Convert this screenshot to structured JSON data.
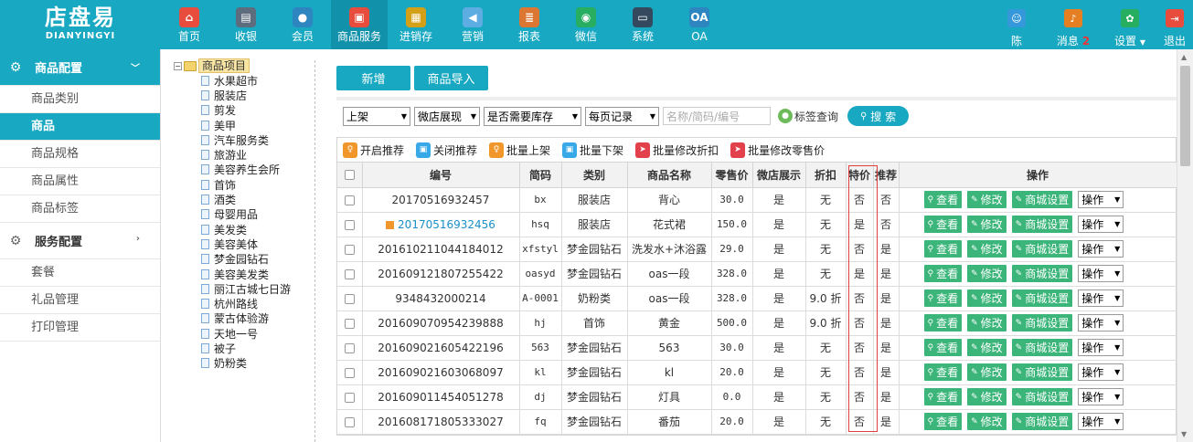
{
  "logo": {
    "cn": "店盘易",
    "en": "DIANYINGYI"
  },
  "nav": [
    {
      "label": "首页",
      "icon": "home-icon",
      "color": "#e74c3c",
      "glyph": "⌂"
    },
    {
      "label": "收银",
      "icon": "cash-register-icon",
      "color": "#5d6d7e",
      "glyph": "▤"
    },
    {
      "label": "会员",
      "icon": "member-icon",
      "color": "#2e86c1",
      "glyph": "●"
    },
    {
      "label": "商品服务",
      "icon": "goods-service-icon",
      "color": "#e74c3c",
      "glyph": "▣"
    },
    {
      "label": "进销存",
      "icon": "inventory-icon",
      "color": "#d4a017",
      "glyph": "▦"
    },
    {
      "label": "营销",
      "icon": "megaphone-icon",
      "color": "#5dade2",
      "glyph": "◀"
    },
    {
      "label": "报表",
      "icon": "report-icon",
      "color": "#dc7633",
      "glyph": "≣"
    },
    {
      "label": "微信",
      "icon": "wechat-icon",
      "color": "#27ae60",
      "glyph": "◉"
    },
    {
      "label": "系统",
      "icon": "monitor-icon",
      "color": "#34495e",
      "glyph": "▭"
    },
    {
      "label": "OA",
      "icon": "oa-icon",
      "color": "#2e86c1",
      "glyph": "OA"
    }
  ],
  "right_nav": {
    "user": {
      "label": "陈",
      "color": "#3498db"
    },
    "messages": {
      "label": "消息",
      "count": "2",
      "color": "#e67e22"
    },
    "settings": {
      "label": "设置",
      "color": "#27ae60"
    },
    "logout": {
      "label": "退出",
      "color": "#e74c3c"
    }
  },
  "sidebar": {
    "group1": {
      "label": "商品配置",
      "items": [
        "商品类别",
        "商品",
        "商品规格",
        "商品属性",
        "商品标签"
      ]
    },
    "group2": {
      "label": "服务配置",
      "items": [
        "套餐",
        "礼品管理",
        "打印管理"
      ]
    }
  },
  "tree": {
    "root": "商品项目",
    "children": [
      "水果超市",
      "服装店",
      "剪发",
      "美甲",
      "汽车服务类",
      "旅游业",
      "美容养生会所",
      "首饰",
      "酒类",
      "母婴用品",
      "美发类",
      "美容美体",
      "梦金园钻石",
      "美容美发类",
      "丽江古城七日游",
      "杭州路线",
      "蒙古体验游",
      "天地一号",
      "被子",
      "奶粉类"
    ]
  },
  "toolbar": {
    "add_label": "新增",
    "import_label": "商品导入"
  },
  "filters": {
    "status": "上架",
    "display": "微店展现",
    "stock": "是否需要库存",
    "page_size": "每页记录",
    "search_placeholder": "名称/简码/编号",
    "tag_query": "标签查询",
    "search_label": "搜 索"
  },
  "actions": [
    "开启推荐",
    "关闭推荐",
    "批量上架",
    "批量下架",
    "批量修改折扣",
    "批量修改零售价"
  ],
  "table": {
    "headers": [
      "编号",
      "简码",
      "类别",
      "商品名称",
      "零售价",
      "微店展示",
      "折扣",
      "特价",
      "推荐",
      "操作"
    ],
    "row_buttons": {
      "view": "查看",
      "edit": "修改",
      "mall": "商城设置",
      "ops": "操作"
    },
    "rows": [
      {
        "code": "20170516932457",
        "short": "bx",
        "category": "服装店",
        "name": "背心",
        "price": "30.0",
        "shop": "是",
        "discount": "无",
        "special": "否",
        "recommend": "否",
        "link": false,
        "special_red": false,
        "recommend_red": true
      },
      {
        "code": "20170516932456",
        "short": "hsq",
        "category": "服装店",
        "name": "花式裙",
        "price": "150.0",
        "shop": "是",
        "discount": "无",
        "special": "是",
        "recommend": "否",
        "link": true,
        "special_red": true,
        "recommend_red": true
      },
      {
        "code": "201610211044184012",
        "short": "xfstyl",
        "category": "梦金园钻石",
        "name": "洗发水+沐浴露",
        "price": "29.0",
        "shop": "是",
        "discount": "无",
        "special": "否",
        "recommend": "是",
        "link": false,
        "special_red": false,
        "recommend_red": false
      },
      {
        "code": "201609121807255422",
        "short": "oasyd",
        "category": "梦金园钻石",
        "name": "oas一段",
        "price": "328.0",
        "shop": "是",
        "discount": "无",
        "special": "是",
        "recommend": "是",
        "link": false,
        "special_red": true,
        "recommend_red": false
      },
      {
        "code": "9348432000214",
        "short": "A-0001",
        "category": "奶粉类",
        "name": "oas一段",
        "price": "328.0",
        "shop": "是",
        "discount": "9.0 折",
        "special": "否",
        "recommend": "是",
        "link": false,
        "special_red": false,
        "recommend_red": false
      },
      {
        "code": "201609070954239888",
        "short": "hj",
        "category": "首饰",
        "name": "黄金",
        "price": "500.0",
        "shop": "是",
        "discount": "9.0 折",
        "special": "否",
        "recommend": "是",
        "link": false,
        "special_red": false,
        "recommend_red": false
      },
      {
        "code": "201609021605422196",
        "short": "563",
        "category": "梦金园钻石",
        "name": "563",
        "price": "30.0",
        "shop": "是",
        "discount": "无",
        "special": "否",
        "recommend": "是",
        "link": false,
        "special_red": false,
        "recommend_red": false
      },
      {
        "code": "201609021603068097",
        "short": "kl",
        "category": "梦金园钻石",
        "name": "kl",
        "price": "20.0",
        "shop": "是",
        "discount": "无",
        "special": "否",
        "recommend": "是",
        "link": false,
        "special_red": false,
        "recommend_red": false
      },
      {
        "code": "201609011454051278",
        "short": "dj",
        "category": "梦金园钻石",
        "name": "灯具",
        "price": "0.0",
        "shop": "是",
        "discount": "无",
        "special": "否",
        "recommend": "是",
        "link": false,
        "special_red": false,
        "recommend_red": false
      },
      {
        "code": "201608171805333027",
        "short": "fq",
        "category": "梦金园钻石",
        "name": "番茄",
        "price": "20.0",
        "shop": "是",
        "discount": "无",
        "special": "否",
        "recommend": "是",
        "link": false,
        "special_red": false,
        "recommend_red": false
      }
    ]
  },
  "colors": {
    "primary": "#18a8c2",
    "green_button": "#3bb57a",
    "red_text": "#e3242b"
  }
}
